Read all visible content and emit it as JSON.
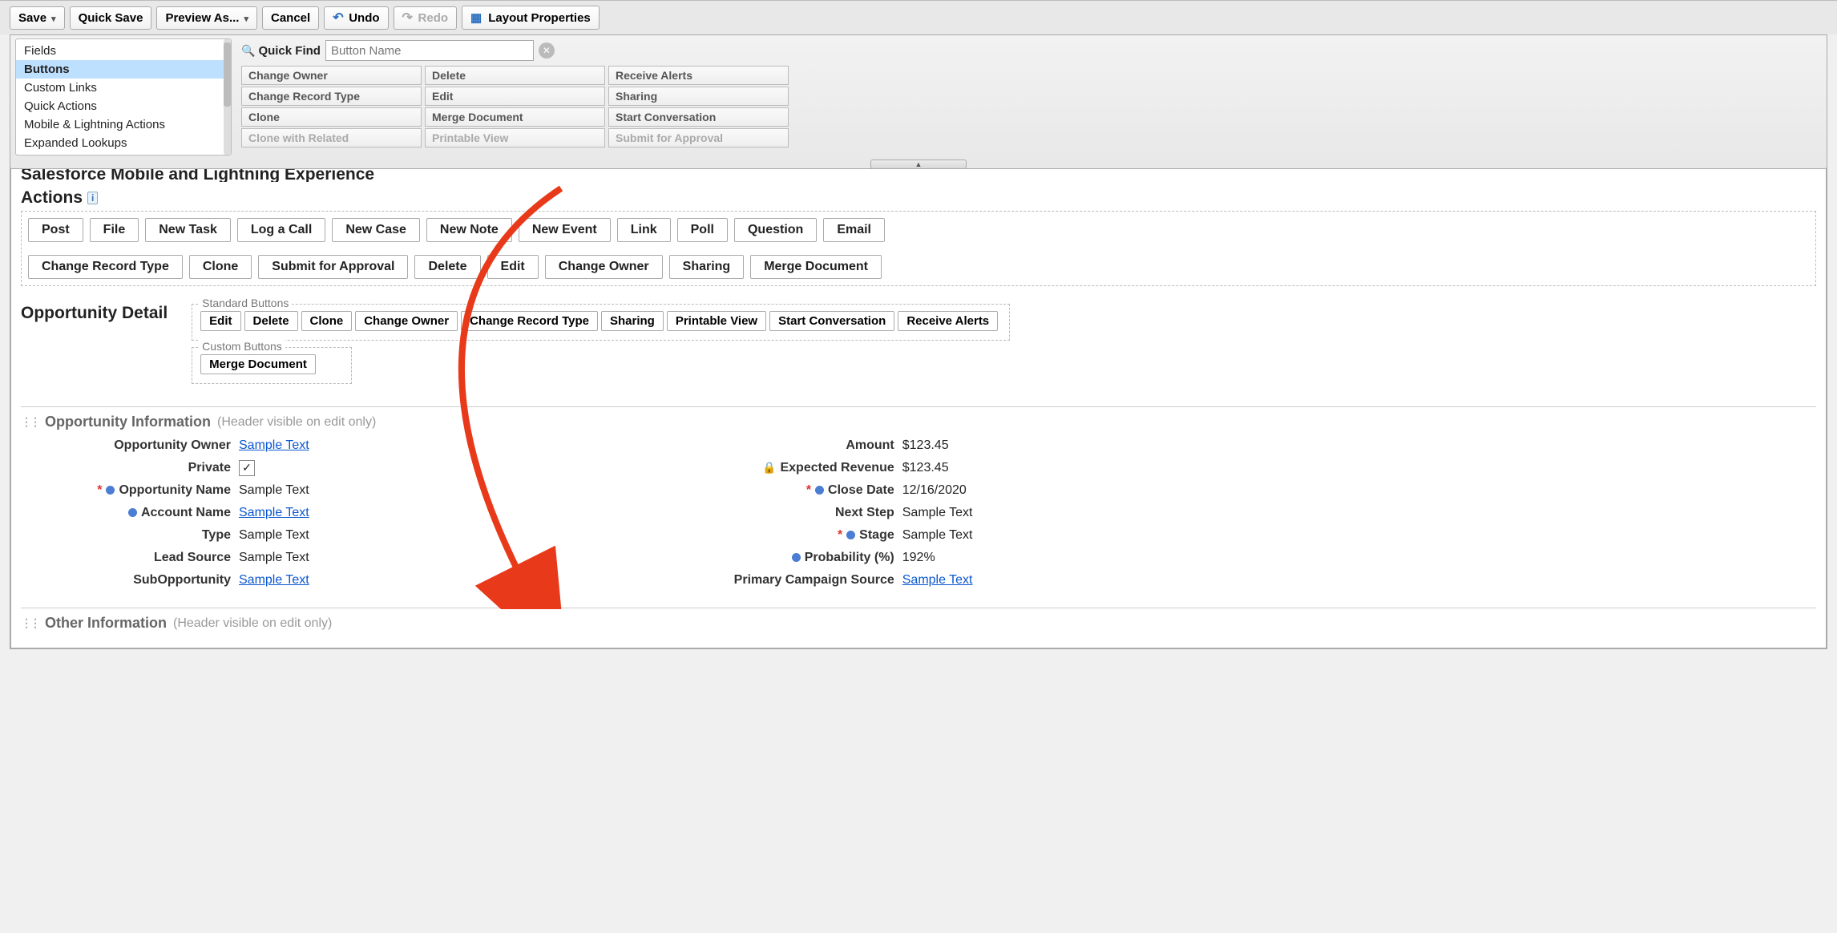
{
  "toolbar": {
    "save": "Save",
    "quick_save": "Quick Save",
    "preview_as": "Preview As...",
    "cancel": "Cancel",
    "undo": "Undo",
    "redo": "Redo",
    "layout_props": "Layout Properties"
  },
  "palette": {
    "categories": [
      "Fields",
      "Buttons",
      "Custom Links",
      "Quick Actions",
      "Mobile & Lightning Actions",
      "Expanded Lookups"
    ],
    "selected_index": 1,
    "quick_find_label": "Quick Find",
    "quick_find_placeholder": "Button Name",
    "columns": [
      [
        "Change Owner",
        "Change Record Type",
        "Clone",
        "Clone with Related"
      ],
      [
        "Delete",
        "Edit",
        "Merge Document",
        "Printable View"
      ],
      [
        "Receive Alerts",
        "Sharing",
        "Start Conversation",
        "Submit for Approval"
      ]
    ],
    "disabled_row": 3
  },
  "actions_section": {
    "title_line1": "Salesforce Mobile and Lightning Experience",
    "title_line2": "Actions",
    "row1": [
      "Post",
      "File",
      "New Task",
      "Log a Call",
      "New Case",
      "New Note",
      "New Event",
      "Link",
      "Poll",
      "Question",
      "Email"
    ],
    "row2": [
      "Change Record Type",
      "Clone",
      "Submit for Approval",
      "Delete",
      "Edit",
      "Change Owner",
      "Sharing",
      "Merge Document"
    ]
  },
  "detail": {
    "title": "Opportunity Detail",
    "standard_label": "Standard Buttons",
    "standard_buttons": [
      "Edit",
      "Delete",
      "Clone",
      "Change Owner",
      "Change Record Type",
      "Sharing",
      "Printable View",
      "Start Conversation",
      "Receive Alerts"
    ],
    "custom_label": "Custom Buttons",
    "custom_buttons": [
      "Merge Document"
    ]
  },
  "info_sections": [
    {
      "title": "Opportunity Information",
      "sub": "(Header visible on edit only)",
      "left": [
        {
          "label": "Opportunity Owner",
          "value": "Sample Text",
          "link": true
        },
        {
          "label": "Private",
          "value": "✓",
          "check": true
        },
        {
          "label": "Opportunity Name",
          "value": "Sample Text",
          "req": true,
          "dot": true
        },
        {
          "label": "Account Name",
          "value": "Sample Text",
          "link": true,
          "dot": true
        },
        {
          "label": "Type",
          "value": "Sample Text"
        },
        {
          "label": "Lead Source",
          "value": "Sample Text"
        },
        {
          "label": "SubOpportunity",
          "value": "Sample Text",
          "link": true
        }
      ],
      "right": [
        {
          "label": "Amount",
          "value": "$123.45"
        },
        {
          "label": "Expected Revenue",
          "value": "$123.45",
          "lock": true
        },
        {
          "label": "Close Date",
          "value": "12/16/2020",
          "req": true,
          "dot": true
        },
        {
          "label": "Next Step",
          "value": "Sample Text"
        },
        {
          "label": "Stage",
          "value": "Sample Text",
          "req": true,
          "dot": true
        },
        {
          "label": "Probability (%)",
          "value": "192%",
          "dot": true
        },
        {
          "label": "Primary Campaign Source",
          "value": "Sample Text",
          "link": true
        }
      ]
    },
    {
      "title": "Other Information",
      "sub": "(Header visible on edit only)",
      "left": [],
      "right": []
    }
  ]
}
